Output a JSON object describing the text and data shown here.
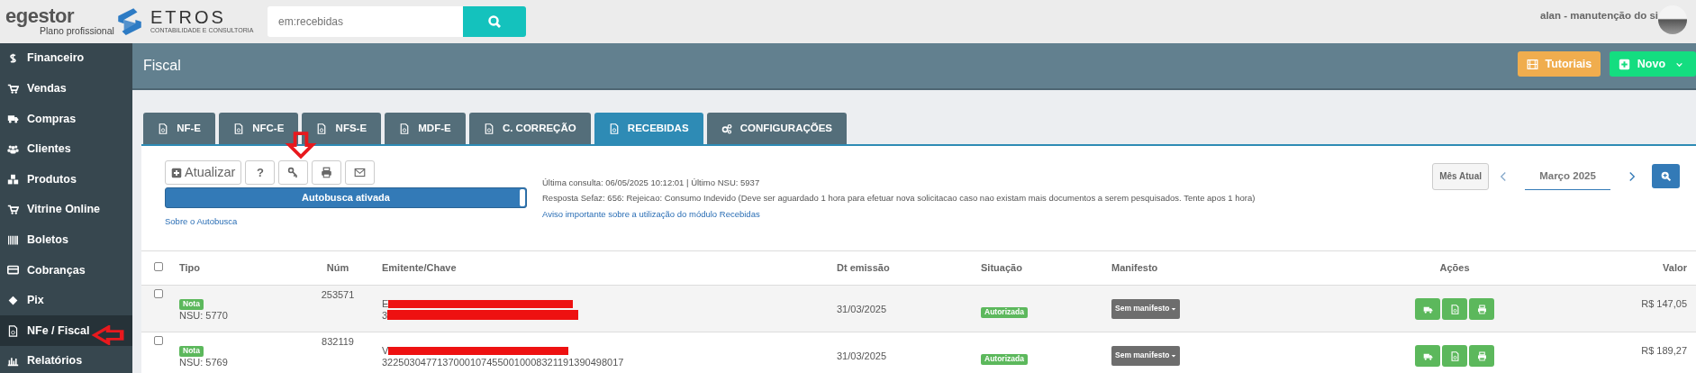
{
  "header": {
    "brand": "egestor",
    "plan": "Plano profissional",
    "partner": "ETROS",
    "partner_tagline": "CONTABILIDADE E CONSULTORIA",
    "search": {
      "placeholder": "em:recebidas"
    },
    "user": "alan - manutenção do si"
  },
  "sidebar": {
    "items": [
      {
        "label": "Financeiro",
        "selected": false
      },
      {
        "label": "Vendas",
        "selected": false
      },
      {
        "label": "Compras",
        "selected": false
      },
      {
        "label": "Clientes",
        "selected": false
      },
      {
        "label": "Produtos",
        "selected": false
      },
      {
        "label": "Vitrine Online",
        "selected": false
      },
      {
        "label": "Boletos",
        "selected": false
      },
      {
        "label": "Cobranças",
        "selected": false
      },
      {
        "label": "Pix",
        "selected": false
      },
      {
        "label": "NFe / Fiscal",
        "selected": true
      },
      {
        "label": "Relatórios",
        "selected": false
      }
    ]
  },
  "page": {
    "title": "Fiscal",
    "buttons": [
      {
        "label": "Tutoriais",
        "kind": "tutorial"
      },
      {
        "label": "Novo",
        "kind": "new"
      }
    ]
  },
  "tabs": [
    {
      "label": "NF-E",
      "selected": false
    },
    {
      "label": "NFC-E",
      "selected": false
    },
    {
      "label": "NFS-E",
      "selected": false
    },
    {
      "label": "MDF-E",
      "selected": false
    },
    {
      "label": "C. CORREÇÃO",
      "selected": false
    },
    {
      "label": "RECEBIDAS",
      "selected": true
    },
    {
      "label": "CONFIGURAÇÕES",
      "selected": false
    }
  ],
  "toolbar": {
    "refresh": "Atualizar",
    "help": "?"
  },
  "autobusca": {
    "label": "Autobusca ativada",
    "on": true,
    "link": "Sobre o Autobusca"
  },
  "info": {
    "last_query": "Última consulta: 06/05/2025 10:12:01 | Último NSU: 5937",
    "sefaz": "Resposta Sefaz: 656: Rejeicao: Consumo Indevido (Deve ser aguardado 1 hora para efetuar nova solicitacao caso nao existam mais documentos a serem pesquisados. Tente apos 1 hora)",
    "notice_link": "Aviso importante sobre a utilização do módulo Recebidas"
  },
  "period": {
    "current_button": "Mês Atual",
    "month": "Março 2025"
  },
  "table": {
    "select_all_checked": false,
    "columns": [
      "Tipo",
      "Núm",
      "Emitente/Chave",
      "Dt emissão",
      "Situação",
      "Manifesto",
      "Ações",
      "Valor"
    ],
    "rows": [
      {
        "checked": false,
        "tipo": "Nota",
        "nsu": "NSU: 5770",
        "num": "253571",
        "emitente": "E",
        "chave": "3",
        "dt": "31/03/2025",
        "situacao": "Autorizada",
        "manifesto": "Sem manifesto",
        "valor": "R$ 147,05"
      },
      {
        "checked": false,
        "tipo": "Nota",
        "nsu": "NSU: 5769",
        "num": "832119",
        "emitente": "V",
        "chave": "32250304771370001074550010008321191390498017",
        "dt": "31/03/2025",
        "situacao": "Autorizada",
        "manifesto": "Sem manifesto",
        "valor": "R$ 189,27"
      }
    ]
  }
}
